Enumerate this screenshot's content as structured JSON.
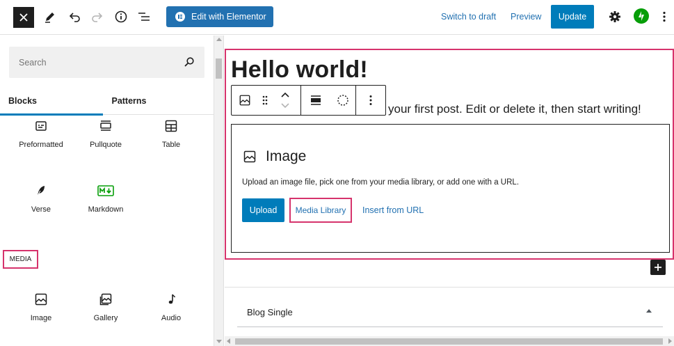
{
  "topbar": {
    "elementor_label": "Edit with Elementor",
    "switch_to_draft": "Switch to draft",
    "preview": "Preview",
    "update": "Update"
  },
  "sidebar": {
    "search_placeholder": "Search",
    "tabs": [
      {
        "label": "Blocks",
        "active": true
      },
      {
        "label": "Patterns",
        "active": false
      }
    ],
    "blocks": [
      {
        "label": "Preformatted",
        "icon": "preformatted-icon"
      },
      {
        "label": "Pullquote",
        "icon": "pullquote-icon"
      },
      {
        "label": "Table",
        "icon": "table-icon"
      },
      {
        "label": "Verse",
        "icon": "verse-icon"
      },
      {
        "label": "Markdown",
        "icon": "markdown-icon"
      }
    ],
    "media_heading": "MEDIA",
    "media_blocks": [
      {
        "label": "Image",
        "icon": "image-icon"
      },
      {
        "label": "Gallery",
        "icon": "gallery-icon"
      },
      {
        "label": "Audio",
        "icon": "audio-icon"
      }
    ]
  },
  "editor": {
    "post_title": "Hello world!",
    "paragraph_tail": "your first post. Edit or delete it, then start writing!",
    "image_block": {
      "title": "Image",
      "instructions": "Upload an image file, pick one from your media library, or add one with a URL.",
      "upload": "Upload",
      "media_library": "Media Library",
      "insert_url": "Insert from URL"
    },
    "meta_box_title": "Blog Single"
  },
  "colors": {
    "accent": "#007cba",
    "link": "#2271b1",
    "highlight": "#d6336c",
    "jetpack": "#069e08"
  }
}
